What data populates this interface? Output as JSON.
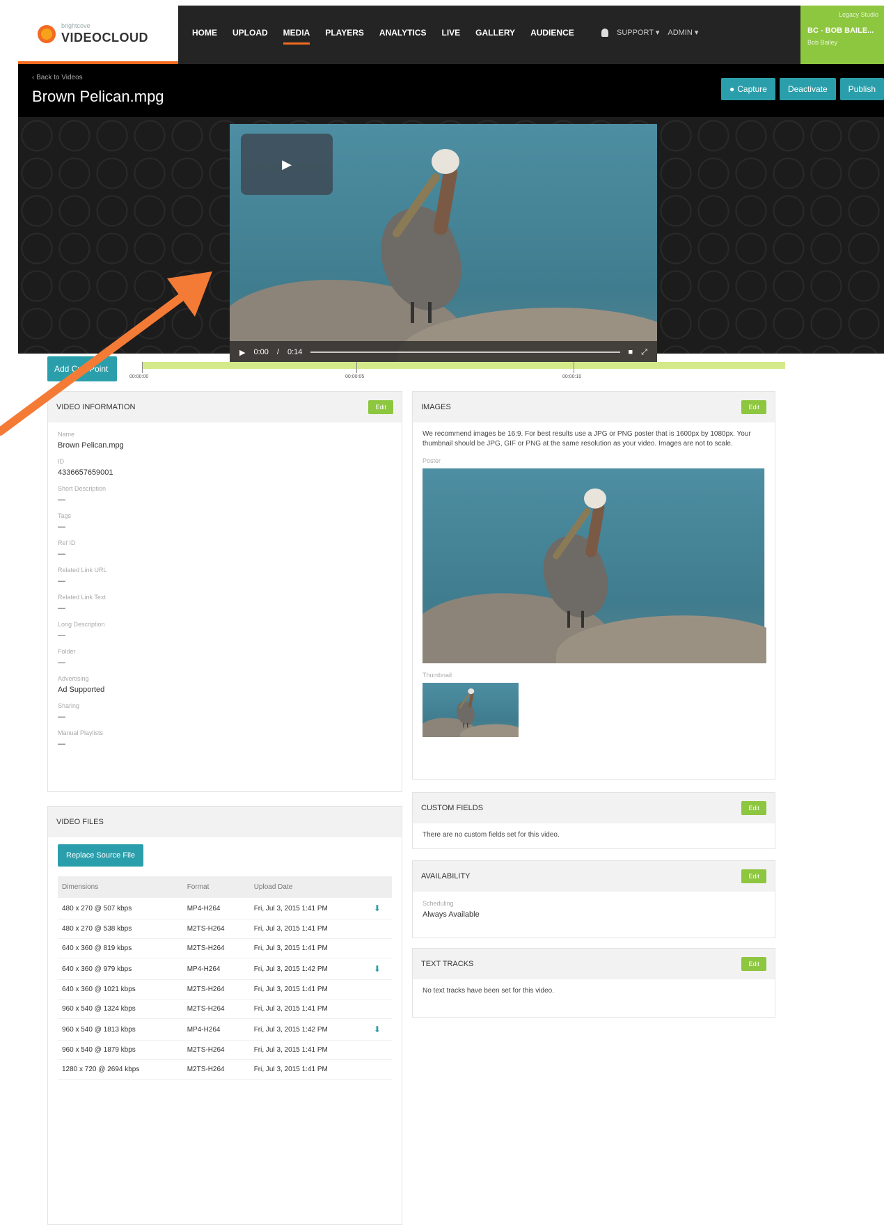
{
  "brand": {
    "small": "brightcove",
    "name": "VIDEOCLOUD"
  },
  "nav": [
    "HOME",
    "UPLOAD",
    "MEDIA",
    "PLAYERS",
    "ANALYTICS",
    "LIVE",
    "GALLERY",
    "AUDIENCE"
  ],
  "nav_active": "MEDIA",
  "nav_right": {
    "support": "SUPPORT ▾",
    "admin": "ADMIN ▾"
  },
  "account": {
    "legacy": "Legacy Studio",
    "name": "BC - BOB BAILE...",
    "user": "Bob Bailey"
  },
  "titlebar": {
    "back": "‹ Back to Videos",
    "title": "Brown Pelican.mpg",
    "capture": "Capture",
    "deactivate": "Deactivate",
    "publish": "Publish"
  },
  "player": {
    "time": "0:00",
    "sep": "/",
    "duration": "0:14"
  },
  "cue": {
    "button": "Add Cue Point",
    "ticks": [
      "00:00:00",
      "00:00:05",
      "00:00:10"
    ]
  },
  "video_info": {
    "header": "VIDEO INFORMATION",
    "edit": "Edit",
    "fields": [
      {
        "label": "Name",
        "value": "Brown Pelican.mpg"
      },
      {
        "label": "ID",
        "value": "4336657659001"
      },
      {
        "label": "Short Description",
        "value": "—"
      },
      {
        "label": "Tags",
        "value": "—"
      },
      {
        "label": "Ref ID",
        "value": "—"
      },
      {
        "label": "Related Link URL",
        "value": "—"
      },
      {
        "label": "Related Link Text",
        "value": "—"
      },
      {
        "label": "Long Description",
        "value": "—"
      },
      {
        "label": "Folder",
        "value": "—"
      },
      {
        "label": "Advertising",
        "value": "Ad Supported"
      },
      {
        "label": "Sharing",
        "value": "—"
      },
      {
        "label": "Manual Playlists",
        "value": "—"
      }
    ]
  },
  "video_files": {
    "header": "VIDEO FILES",
    "replace": "Replace Source File",
    "columns": [
      "Dimensions",
      "Format",
      "Upload Date",
      ""
    ],
    "rows": [
      {
        "dim": "480 x 270 @ 507 kbps",
        "fmt": "MP4-H264",
        "date": "Fri, Jul 3, 2015 1:41 PM",
        "dl": true
      },
      {
        "dim": "480 x 270 @ 538 kbps",
        "fmt": "M2TS-H264",
        "date": "Fri, Jul 3, 2015 1:41 PM",
        "dl": false
      },
      {
        "dim": "640 x 360 @ 819 kbps",
        "fmt": "M2TS-H264",
        "date": "Fri, Jul 3, 2015 1:41 PM",
        "dl": false
      },
      {
        "dim": "640 x 360 @ 979 kbps",
        "fmt": "MP4-H264",
        "date": "Fri, Jul 3, 2015 1:42 PM",
        "dl": true
      },
      {
        "dim": "640 x 360 @ 1021 kbps",
        "fmt": "M2TS-H264",
        "date": "Fri, Jul 3, 2015 1:41 PM",
        "dl": false
      },
      {
        "dim": "960 x 540 @ 1324 kbps",
        "fmt": "M2TS-H264",
        "date": "Fri, Jul 3, 2015 1:41 PM",
        "dl": false
      },
      {
        "dim": "960 x 540 @ 1813 kbps",
        "fmt": "MP4-H264",
        "date": "Fri, Jul 3, 2015 1:42 PM",
        "dl": true
      },
      {
        "dim": "960 x 540 @ 1879 kbps",
        "fmt": "M2TS-H264",
        "date": "Fri, Jul 3, 2015 1:41 PM",
        "dl": false
      },
      {
        "dim": "1280 x 720 @ 2694 kbps",
        "fmt": "M2TS-H264",
        "date": "Fri, Jul 3, 2015 1:41 PM",
        "dl": false
      }
    ]
  },
  "images": {
    "header": "IMAGES",
    "edit": "Edit",
    "note": "We recommend images be 16:9. For best results use a JPG or PNG poster that is 1600px by 1080px. Your thumbnail should be JPG, GIF or PNG at the same resolution as your video. Images are not to scale.",
    "poster_label": "Poster",
    "thumb_label": "Thumbnail"
  },
  "custom_fields": {
    "header": "CUSTOM FIELDS",
    "edit": "Edit",
    "text": "There are no custom fields set for this video."
  },
  "availability": {
    "header": "AVAILABILITY",
    "edit": "Edit",
    "label": "Scheduling",
    "value": "Always Available"
  },
  "text_tracks": {
    "header": "TEXT TRACKS",
    "edit": "Edit",
    "text": "No text tracks have been set for this video."
  },
  "colors": {
    "accent": "#f26b21",
    "teal": "#2a9fab",
    "green": "#8dc63f"
  }
}
